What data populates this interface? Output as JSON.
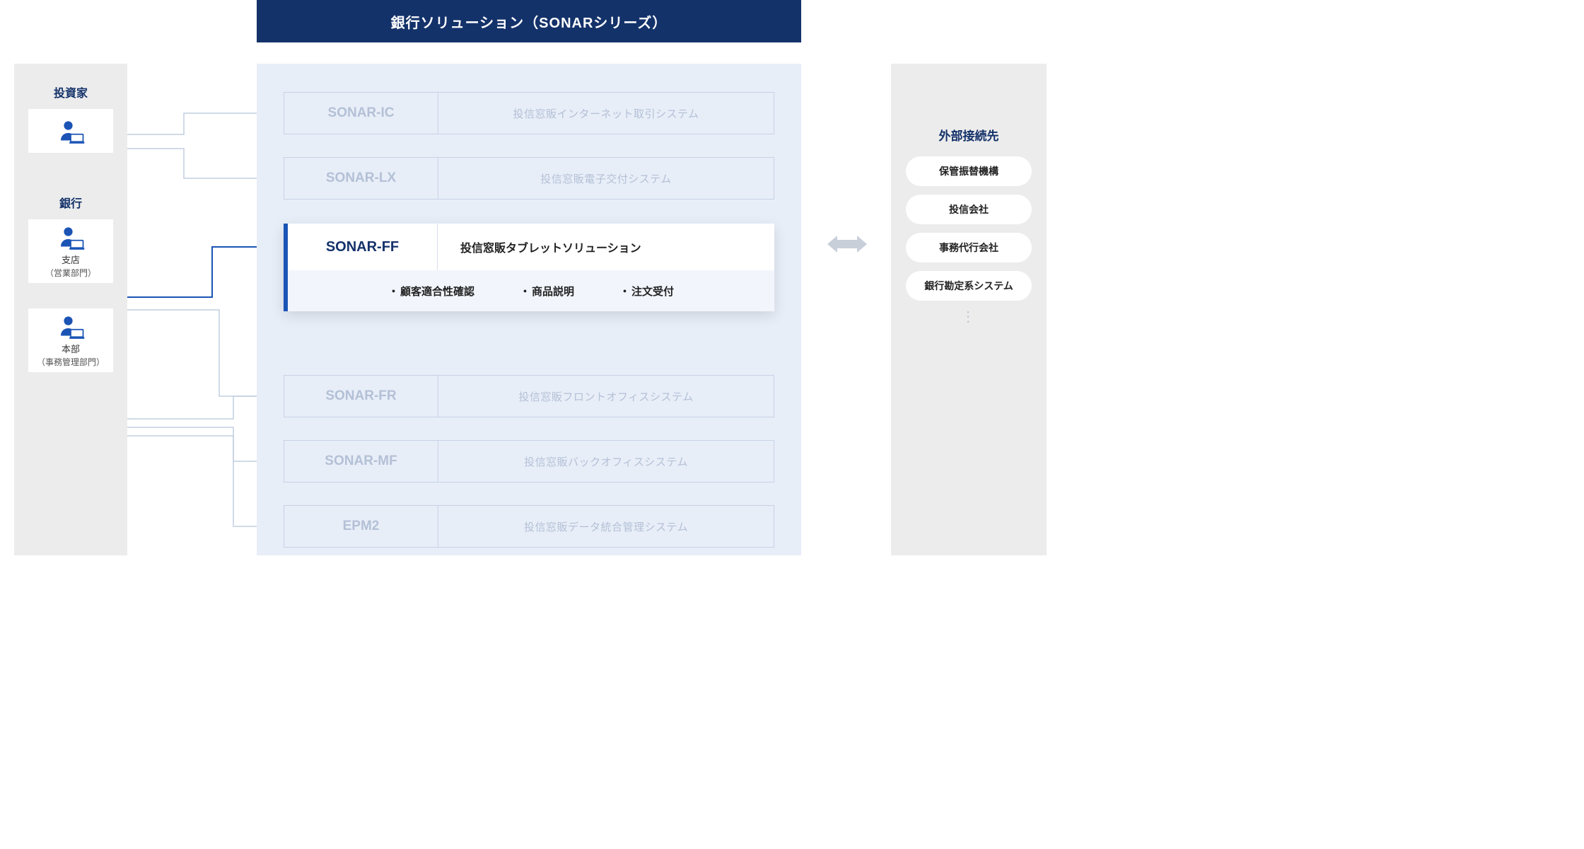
{
  "header": {
    "title": "銀行ソリューション（SONARシリーズ）"
  },
  "left": {
    "investor_title": "投資家",
    "bank_title": "銀行",
    "branch_label": "支店",
    "branch_sublabel": "（営業部門）",
    "hq_label": "本部",
    "hq_sublabel": "（事務管理部門）"
  },
  "products": {
    "ic": {
      "code": "SONAR-IC",
      "desc": "投信窓販インターネット取引システム"
    },
    "lx": {
      "code": "SONAR-LX",
      "desc": "投信窓販電子交付システム"
    },
    "ff": {
      "code": "SONAR-FF",
      "desc": "投信窓販タブレットソリューション",
      "features": [
        "顧客適合性確認",
        "商品説明",
        "注文受付"
      ]
    },
    "fr": {
      "code": "SONAR-FR",
      "desc": "投信窓販フロントオフィスシステム"
    },
    "mf": {
      "code": "SONAR-MF",
      "desc": "投信窓販バックオフィスシステム"
    },
    "epm": {
      "code": "EPM2",
      "desc": "投信窓販データ統合管理システム"
    }
  },
  "right": {
    "title": "外部接続先",
    "items": [
      "保管振替機構",
      "投信会社",
      "事務代行会社",
      "銀行勘定系システム"
    ]
  },
  "colors": {
    "navy": "#14326A",
    "blue_accent": "#1B54B5",
    "panel_tint": "#E8EEF8",
    "panel_gray": "#ECECEC",
    "muted_text": "#B3C0D6"
  }
}
